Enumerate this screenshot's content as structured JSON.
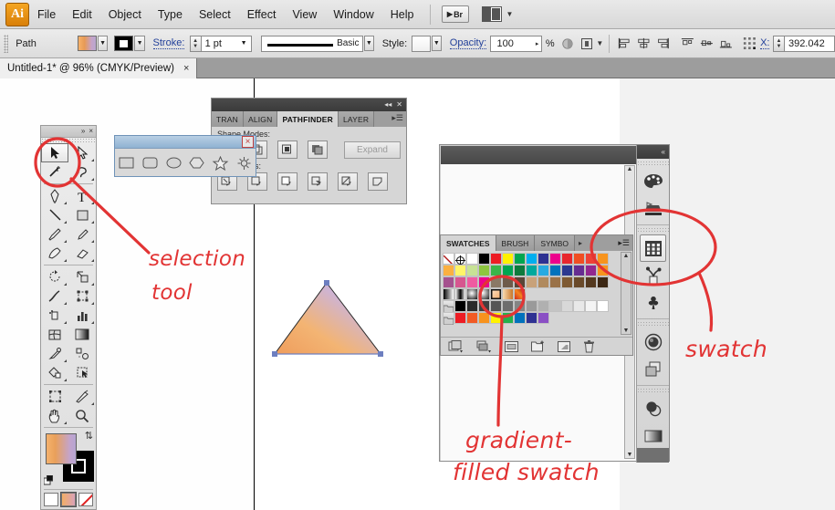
{
  "app": {
    "logo": "Ai",
    "menus": [
      "File",
      "Edit",
      "Object",
      "Type",
      "Select",
      "Effect",
      "View",
      "Window",
      "Help"
    ],
    "bridge_button": "Br"
  },
  "control_bar": {
    "object_label": "Path",
    "stroke_label": "Stroke:",
    "stroke_weight": "1 pt",
    "stroke_profile": "Basic",
    "style_label": "Style:",
    "opacity_label": "Opacity:",
    "opacity_value": "100",
    "percent": "%",
    "x_label": "X:",
    "x_value": "392.042",
    "fill_color": "#e9a05a",
    "stroke_color": "#000000"
  },
  "document_tab": {
    "title": "Untitled-1* @ 96% (CMYK/Preview)",
    "close": "×"
  },
  "toolbox": {
    "collapse_icon": "»",
    "close_icon": "×",
    "tools": [
      "selection-tool",
      "direct-selection-tool",
      "magic-wand-tool",
      "lasso-tool",
      "pen-tool",
      "type-tool",
      "line-segment-tool",
      "rectangle-tool",
      "paintbrush-tool",
      "pencil-tool",
      "blob-brush-tool",
      "eraser-tool",
      "rotate-tool",
      "scale-tool",
      "width-tool",
      "free-transform-tool",
      "symbol-sprayer-tool",
      "column-graph-tool",
      "mesh-tool",
      "gradient-tool",
      "eyedropper-tool",
      "blend-tool",
      "live-paint-bucket-tool",
      "live-paint-selection-tool",
      "artboard-tool",
      "slice-tool",
      "hand-tool",
      "zoom-tool"
    ],
    "selected_tool": "selection-tool",
    "fill_gradient": "#f5b26e → #b6a5d2",
    "stroke_color": "#000000",
    "screen_modes": [
      "color-mode",
      "gradient-mode",
      "none-mode"
    ]
  },
  "shape_popup": {
    "close": "×",
    "tools": [
      "rectangle-tool",
      "rounded-rectangle-tool",
      "ellipse-tool",
      "polygon-tool",
      "star-tool",
      "flare-tool"
    ]
  },
  "pathfinder_panel": {
    "tabs": [
      "TRAN",
      "ALIGN",
      "PATHFINDER",
      "LAYER"
    ],
    "active_tab": "PATHFINDER",
    "shape_modes_label": "Shape Modes:",
    "pathfinders_label": "Pathfinders:",
    "expand_button": "Expand",
    "shape_mode_buttons": [
      "unite",
      "minus-front",
      "intersect",
      "exclude"
    ],
    "pathfinder_buttons": [
      "divide",
      "trim",
      "merge",
      "crop",
      "outline",
      "minus-back"
    ],
    "menu_icon": "≡"
  },
  "swatches_panel": {
    "tabs": [
      "SWATCHES",
      "BRUSH",
      "SYMBO"
    ],
    "active_tab": "SWATCHES",
    "menu_icon": "≡",
    "more_arrow": "▸",
    "footer_buttons": [
      "swatch-libraries-menu",
      "show-swatch-kinds-menu",
      "swatch-options",
      "new-color-group",
      "new-swatch",
      "delete-swatch"
    ],
    "rows": [
      [
        "none",
        "registration",
        "#ffffff",
        "#000000",
        "#ed1c24",
        "#fff200",
        "#00a650",
        "#00aeef",
        "#2e3192",
        "#ec008c",
        "#ed1c24",
        "#f26522",
        "#ef4136",
        "#f7941e"
      ],
      [
        "#fbb040",
        "#fff568",
        "#c7e295",
        "#8dc63f",
        "#39b54a",
        "#00a651",
        "#0e7a3c",
        "#00a99d",
        "#27aae1",
        "#0072bc",
        "#2b3990",
        "#662d91",
        "#92278f"
      ],
      [
        "#a5518e",
        "#d6568f",
        "#ef5ba1",
        "#ec008c",
        "#8a7967",
        "#6e5b4b",
        "#5a4536",
        "#c8a27a",
        "#b08a5e",
        "#9a7248",
        "#7e5a33",
        "#6a4a2a",
        "#54391f"
      ],
      [
        "gradient-black-white",
        "gradient-gray",
        "gradient-radial-white",
        "gradient-sphere",
        "gradient-orange-selected",
        "gradient-copper",
        "pattern-fire"
      ],
      [
        "group-gray-ramp"
      ],
      [
        "group-brights"
      ]
    ],
    "selected_swatch": "gradient-orange-selected"
  },
  "right_dock": {
    "collapse_icon": "«",
    "icons": [
      {
        "name": "color-panel-icon"
      },
      {
        "name": "color-guide-icon"
      },
      {
        "name": "swatches-panel-icon",
        "selected": true
      },
      {
        "name": "brushes-panel-icon"
      },
      {
        "name": "symbols-panel-icon"
      },
      {
        "name": "appearance-panel-icon"
      },
      {
        "name": "graphic-styles-panel-icon"
      },
      {
        "name": "transparency-panel-icon"
      },
      {
        "name": "gradient-panel-icon"
      }
    ]
  },
  "artwork": {
    "shape": "triangle",
    "fill": "linear-gradient orange to lavender",
    "gradient_start": "#f0a05f",
    "gradient_end": "#b3a6d4",
    "selected": true
  },
  "annotations": [
    {
      "text": "selection",
      "name": "annotation-selection-tool-line1"
    },
    {
      "text": "tool",
      "name": "annotation-selection-tool-line2"
    },
    {
      "text": "swatch",
      "name": "annotation-swatch"
    },
    {
      "text": "gradient-",
      "name": "annotation-gradient-swatch-line1"
    },
    {
      "text": "filled swatch",
      "name": "annotation-gradient-swatch-line2"
    }
  ],
  "annotation_color": "#e23434"
}
